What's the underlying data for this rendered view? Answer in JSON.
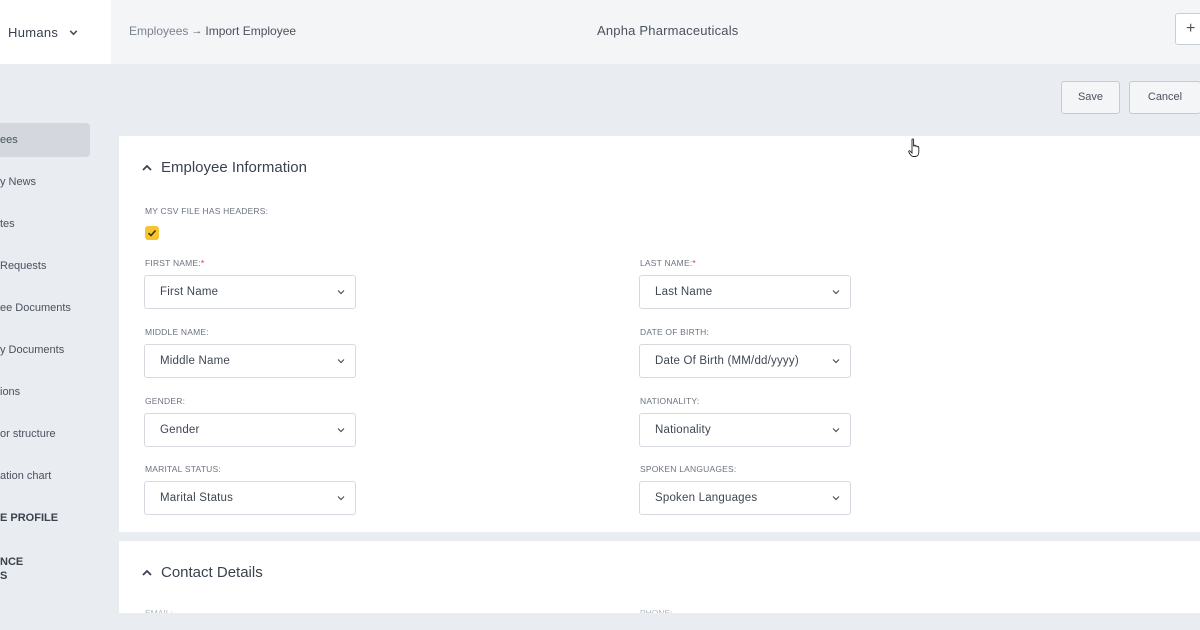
{
  "brand": {
    "label": "Humans"
  },
  "breadcrumb": {
    "parent": "Employees",
    "separator": "→",
    "current": "Import Employee"
  },
  "company": "Anpha Pharmaceuticals",
  "topbar": {
    "add_label": "+"
  },
  "sidebar": {
    "items": [
      {
        "label": "ees",
        "active": true
      },
      {
        "label": "y News"
      },
      {
        "label": "tes"
      },
      {
        "label": "Requests"
      },
      {
        "label": "ee Documents"
      },
      {
        "label": "y Documents"
      },
      {
        "label": "ions"
      },
      {
        "label": "or structure"
      },
      {
        "label": "ation chart"
      },
      {
        "label": "E PROFILE"
      },
      {
        "label_line1": "NCE",
        "label_line2": "S"
      }
    ]
  },
  "actions": {
    "save": "Save",
    "cancel": "Cancel"
  },
  "employee_info": {
    "title": "Employee Information",
    "csv_headers_label": "MY CSV FILE HAS HEADERS:",
    "csv_headers_checked": true,
    "fields": {
      "first_name": {
        "label": "FIRST NAME:",
        "required_mark": "*",
        "value": "First Name"
      },
      "last_name": {
        "label": "LAST NAME:",
        "required_mark": "*",
        "value": "Last Name"
      },
      "middle_name": {
        "label": "MIDDLE NAME:",
        "value": "Middle Name"
      },
      "date_of_birth": {
        "label": "DATE OF BIRTH:",
        "value": "Date Of Birth (MM/dd/yyyy)"
      },
      "gender": {
        "label": "GENDER:",
        "value": "Gender"
      },
      "nationality": {
        "label": "NATIONALITY:",
        "value": "Nationality"
      },
      "marital_status": {
        "label": "MARITAL STATUS:",
        "value": "Marital Status"
      },
      "spoken_languages": {
        "label": "SPOKEN LANGUAGES:",
        "value": "Spoken Languages"
      }
    }
  },
  "contact_details": {
    "title": "Contact Details",
    "partial_labels": {
      "left": "EMAIL:",
      "right": "PHONE:"
    }
  },
  "icons": {
    "brand_dropdown": "chevron-down-icon",
    "panel_toggle": "chevron-up-icon",
    "select_arrow": "chevron-down-icon",
    "checkbox": "check-icon",
    "cursor": "hand-pointer-icon"
  },
  "colors": {
    "checkbox": "#f5c430",
    "required": "#e0323a",
    "background": "#e9ecf0"
  }
}
